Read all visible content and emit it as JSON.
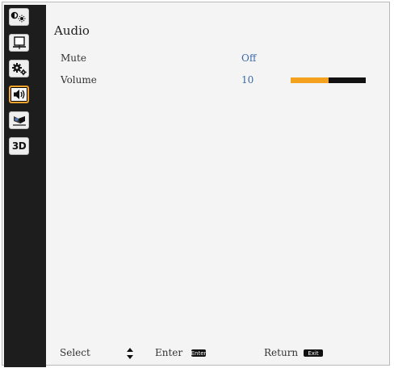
{
  "menu": {
    "sidebar": [
      {
        "icon": "display-picture-icon",
        "active": false
      },
      {
        "icon": "screen-icon",
        "active": false
      },
      {
        "icon": "settings-gears-icon",
        "active": false
      },
      {
        "icon": "speaker-icon",
        "active": true
      },
      {
        "icon": "projector-icon",
        "active": false
      },
      {
        "icon": "3d-icon",
        "label": "3D",
        "active": false
      }
    ],
    "title": "Audio",
    "rows": [
      {
        "label": "Mute",
        "value": "Off"
      },
      {
        "label": "Volume",
        "value": "10",
        "bar_fraction": 0.5
      }
    ],
    "colors": {
      "accent": "#f4a11d",
      "value_text": "#3b6aa6",
      "sidebar_bg": "#1d1d1d"
    }
  },
  "footer": {
    "select_label": "Select",
    "enter_label": "Enter",
    "enter_key": "Enter",
    "return_label": "Return",
    "return_key": "Exit"
  }
}
